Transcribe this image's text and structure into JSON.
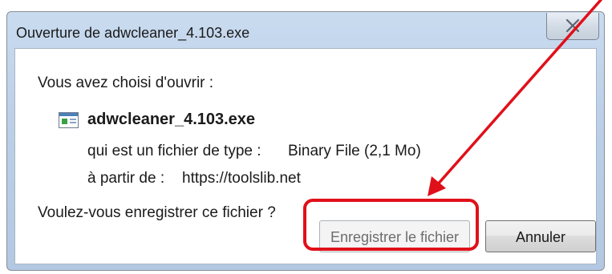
{
  "dialog": {
    "title": "Ouverture de adwcleaner_4.103.exe",
    "intro": "Vous avez choisi d'ouvrir :",
    "file": {
      "icon": "application-window-icon",
      "name": "adwcleaner_4.103.exe",
      "type_label": "qui est un fichier de type :",
      "type_value": "Binary File (2,1 Mo)",
      "source_label": "à partir de :",
      "source_value": "https://toolslib.net"
    },
    "question": "Voulez-vous enregistrer ce fichier ?",
    "buttons": {
      "save_label": "Enregistrer le fichier",
      "cancel_label": "Annuler"
    }
  },
  "annotation": {
    "color": "#e0101a"
  },
  "colors": {
    "frame": "#bcd0e8",
    "client": "#ffffff"
  }
}
